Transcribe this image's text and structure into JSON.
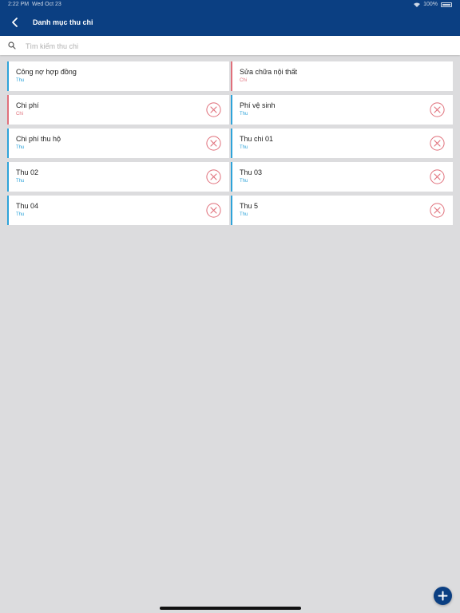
{
  "status": {
    "time": "2:22 PM",
    "date": "Wed Oct 23",
    "battery": "100%"
  },
  "nav": {
    "title": "Danh mục thu chi",
    "back_icon": "chevron-left-icon"
  },
  "search": {
    "placeholder": "Tìm kiếm thu chi",
    "value": "",
    "icon": "search-icon"
  },
  "colors": {
    "header": "#0b3f82",
    "thu": "#2ea3d9",
    "chi": "#e0707b",
    "background": "#dcdcde"
  },
  "categories": [
    {
      "name": "Công nợ hợp đồng",
      "type": "Thu",
      "kind": "thu",
      "deletable": false
    },
    {
      "name": "Sửa chữa nội thất",
      "type": "Chi",
      "kind": "chi",
      "deletable": false
    },
    {
      "name": "Chi phí",
      "type": "Chi",
      "kind": "chi",
      "deletable": true
    },
    {
      "name": "Phí vệ sinh",
      "type": "Thu",
      "kind": "thu",
      "deletable": true
    },
    {
      "name": "Chi phí thu hộ",
      "type": "Thu",
      "kind": "thu",
      "deletable": true
    },
    {
      "name": "Thu chi 01",
      "type": "Thu",
      "kind": "thu",
      "deletable": true
    },
    {
      "name": "Thu 02",
      "type": "Thu",
      "kind": "thu",
      "deletable": true
    },
    {
      "name": "Thu 03",
      "type": "Thu",
      "kind": "thu",
      "deletable": true
    },
    {
      "name": "Thu 04",
      "type": "Thu",
      "kind": "thu",
      "deletable": true
    },
    {
      "name": "Thu 5",
      "type": "Thu",
      "kind": "thu",
      "deletable": true
    }
  ],
  "fab": {
    "icon": "plus-icon"
  }
}
